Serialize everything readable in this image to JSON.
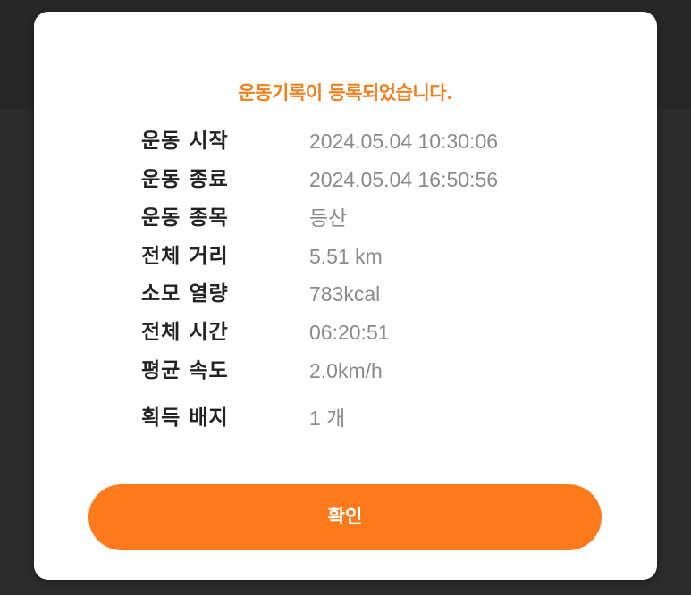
{
  "colors": {
    "accent": "#f07f1e",
    "button": "#fd7a1c",
    "label": "#222222",
    "value": "#8a8a8a",
    "modal_bg": "#ffffff",
    "backdrop": "#2b2b2b"
  },
  "modal": {
    "title": "운동기록이 등록되었습니다.",
    "rows": [
      {
        "label": "운동 시작",
        "value": "2024.05.04 10:30:06"
      },
      {
        "label": "운동 종료",
        "value": "2024.05.04 16:50:56"
      },
      {
        "label": "운동 종목",
        "value": "등산"
      },
      {
        "label": "전체 거리",
        "value": "5.51 km"
      },
      {
        "label": "소모 열량",
        "value": "783kcal"
      },
      {
        "label": "전체 시간",
        "value": "06:20:51"
      },
      {
        "label": "평균 속도",
        "value": "2.0km/h"
      },
      {
        "label": "획득 배지",
        "value": "1 개"
      }
    ],
    "confirm_label": "확인"
  }
}
